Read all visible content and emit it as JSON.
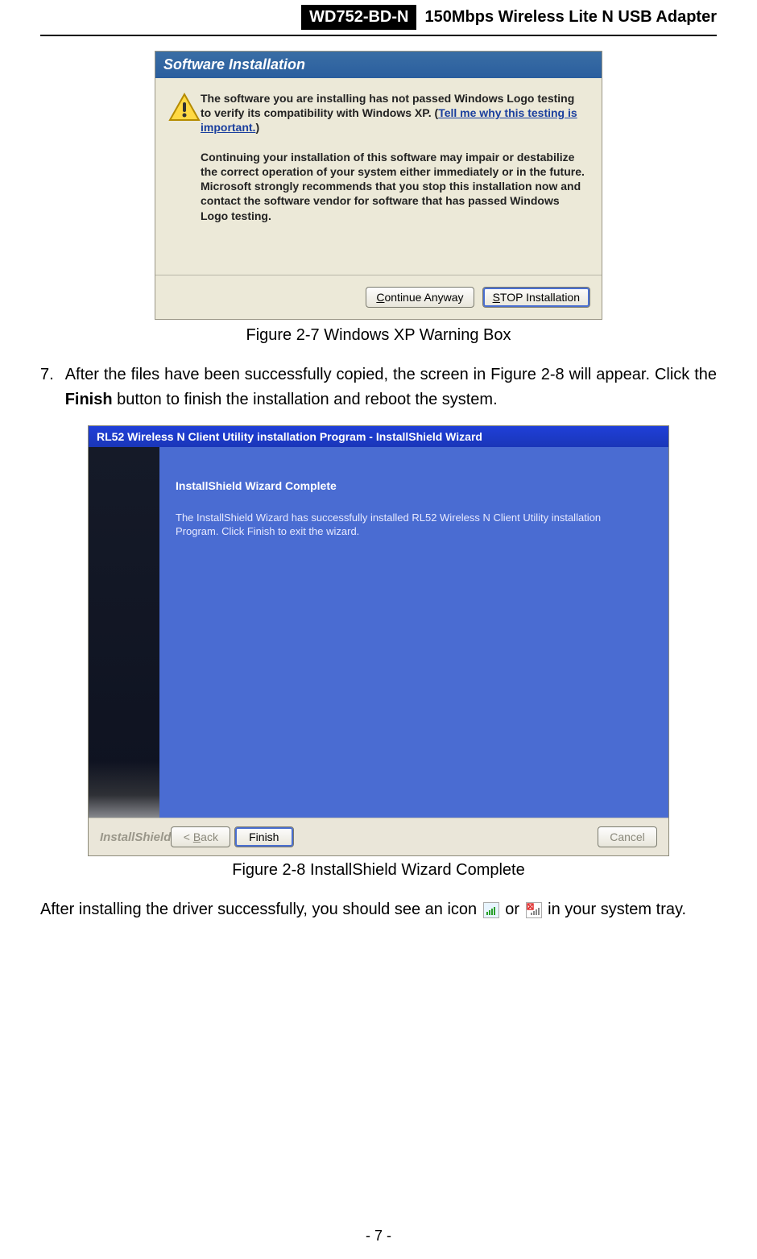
{
  "header": {
    "model": "WD752-BD-N",
    "title": "150Mbps Wireless Lite N USB Adapter"
  },
  "fig1": {
    "window_title": "Software Installation",
    "intro": "The software you are installing has not passed Windows Logo testing to verify its compatibility with Windows XP. (",
    "link": "Tell me why this testing is important.",
    "intro_close": ")",
    "bold_msg": "Continuing your installation of this software may impair or destabilize the correct operation of your system either immediately or in the future. Microsoft strongly recommends that you stop this installation now and contact the software vendor for software that has passed Windows Logo testing.",
    "btn_continue_pre": "C",
    "btn_continue_ul": "ontinue Anyway",
    "btn_stop_pre": "S",
    "btn_stop_ul": "TOP Installation",
    "caption": "Figure 2-7 Windows XP Warning Box"
  },
  "step7": {
    "num": "7.",
    "text_before_bold": "After the files have been successfully copied, the screen in Figure 2-8 will appear. Click the ",
    "bold": "Finish",
    "text_after_bold": " button to finish the installation and reboot the system."
  },
  "fig2": {
    "window_title": "RL52 Wireless N Client Utility installation Program - InstallShield Wizard",
    "heading": "InstallShield Wizard Complete",
    "para": "The InstallShield Wizard has successfully installed RL52 Wireless N Client Utility installation Program.  Click Finish to exit the wizard.",
    "brand": "InstallShield",
    "btn_back_pre": "< ",
    "btn_back_ul": "B",
    "btn_back_post": "ack",
    "btn_finish": "Finish",
    "btn_cancel": "Cancel",
    "caption": "Figure 2-8 InstallShield Wizard Complete"
  },
  "closing": {
    "before": "After installing the driver successfully, you should see an icon ",
    "mid": " or ",
    "after": " in your system tray."
  },
  "page_number": "- 7 -"
}
